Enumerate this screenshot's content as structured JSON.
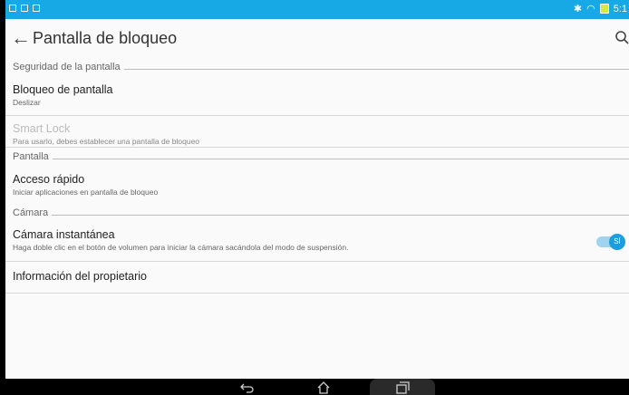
{
  "status_bar": {
    "time": "5:1"
  },
  "app_bar": {
    "title": "Pantalla de bloqueo"
  },
  "sections": {
    "security": {
      "label": "Seguridad de la pantalla",
      "lock": {
        "title": "Bloqueo de pantalla",
        "subtitle": "Deslizar"
      },
      "smart_lock": {
        "title": "Smart Lock",
        "subtitle": "Para usarlo, debes establecer una pantalla de bloqueo"
      }
    },
    "screen": {
      "label": "Pantalla",
      "quick_access": {
        "title": "Acceso rápido",
        "subtitle": "Iniciar aplicaciones en pantalla de bloqueo"
      }
    },
    "camera": {
      "label": "Cámara",
      "instant": {
        "title": "Cámara instantánea",
        "subtitle": "Haga doble clic en el botón de volumen para iniciar la cámara sacándola del modo de suspensión.",
        "toggle_label": "SÍ"
      }
    }
  },
  "owner_info": {
    "title": "Información del propietario"
  },
  "colors": {
    "accent": "#17a9e6",
    "toggle_on": "#1a9ee0"
  }
}
